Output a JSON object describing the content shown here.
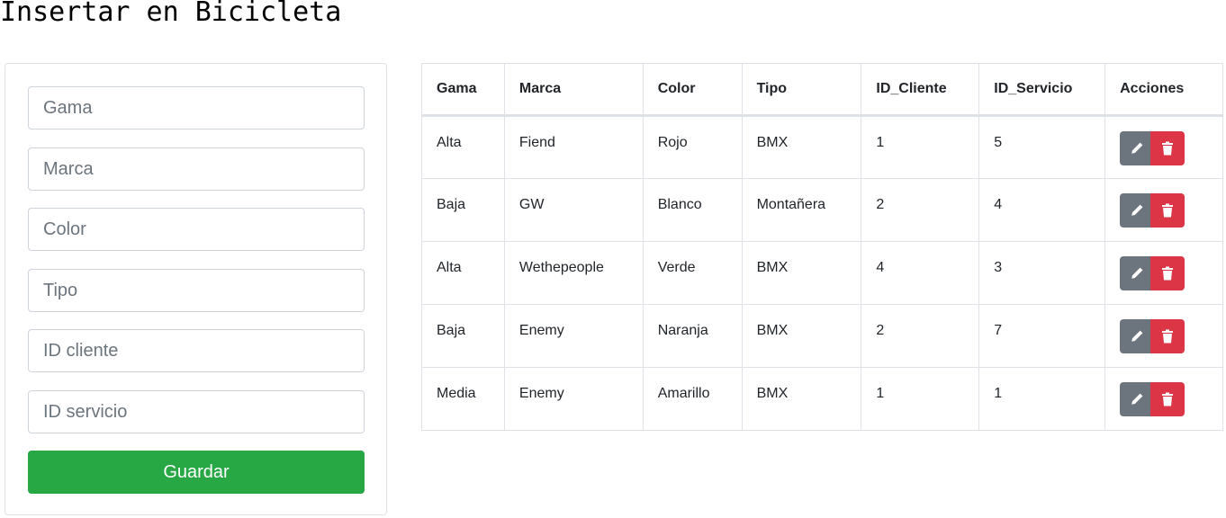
{
  "page": {
    "title": "Insertar en Bicicleta"
  },
  "form": {
    "fields": [
      {
        "placeholder": "Gama",
        "value": ""
      },
      {
        "placeholder": "Marca",
        "value": ""
      },
      {
        "placeholder": "Color",
        "value": ""
      },
      {
        "placeholder": "Tipo",
        "value": ""
      },
      {
        "placeholder": "ID cliente",
        "value": ""
      },
      {
        "placeholder": "ID servicio",
        "value": ""
      }
    ],
    "save_label": "Guardar"
  },
  "table": {
    "columns": [
      "Gama",
      "Marca",
      "Color",
      "Tipo",
      "ID_Cliente",
      "ID_Servicio",
      "Acciones"
    ],
    "rows": [
      [
        "Alta",
        "Fiend",
        "Rojo",
        "BMX",
        "1",
        "5"
      ],
      [
        "Baja",
        "GW",
        "Blanco",
        "Montañera",
        "2",
        "4"
      ],
      [
        "Alta",
        "Wethepeople",
        "Verde",
        "BMX",
        "4",
        "3"
      ],
      [
        "Baja",
        "Enemy",
        "Naranja",
        "BMX",
        "2",
        "7"
      ],
      [
        "Media",
        "Enemy",
        "Amarillo",
        "BMX",
        "1",
        "1"
      ]
    ],
    "row_actions": [
      {
        "icon": "pencil-icon",
        "color": "#6c757d"
      },
      {
        "icon": "trash-icon",
        "color": "#dc3545"
      }
    ]
  },
  "colors": {
    "save": "#28a745",
    "edit": "#6c757d",
    "delete": "#dc3545"
  }
}
